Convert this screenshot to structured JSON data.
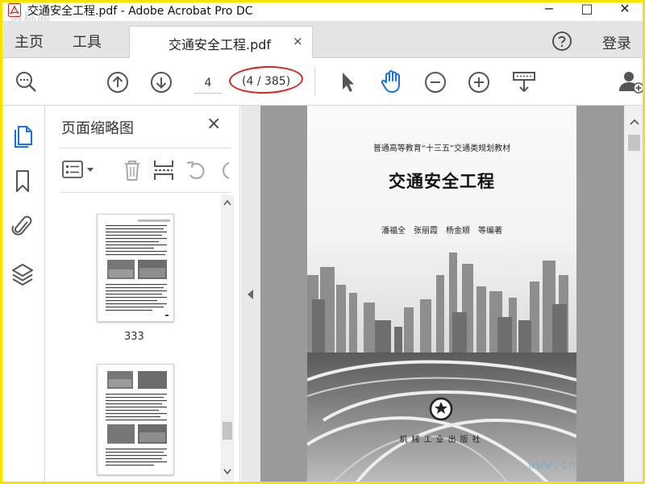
{
  "window": {
    "title": "交通安全工程.pdf - Adobe Acrobat Pro DC",
    "minimize_label": "−",
    "maximize_label": "□",
    "close_label": "✕",
    "watermark_text": "道称网"
  },
  "tabs": {
    "home_label": "主页",
    "tools_label": "工具",
    "document_label": "交通安全工程.pdf",
    "document_close": "×",
    "sign_in_label": "登录"
  },
  "toolbar": {
    "current_page": "4",
    "page_count": "(4 / 385)",
    "icons": [
      "search-icon",
      "previous-page-icon",
      "next-page-icon",
      "select-arrow-icon",
      "hand-tool-icon",
      "zoom-out-icon",
      "zoom-in-icon",
      "page-fit-icon",
      "share-user-icon"
    ],
    "accent_color": "#1473e6",
    "annotation_color": "#d9241c"
  },
  "sidebar": {
    "icons": [
      "page-thumbnails-icon",
      "bookmark-icon",
      "attachment-icon",
      "layers-icon"
    ]
  },
  "thumbnails_panel": {
    "title": "页面缩略图",
    "close": "×",
    "thumbnails": [
      {
        "label": "333"
      },
      {
        "label": ""
      }
    ]
  },
  "document": {
    "series": "普通高等教育“十三五”交通类规划教材",
    "title": "交通安全工程",
    "authors": "潘福全　张丽霞　杨金顺　等编著",
    "publisher": "机械工业出版社",
    "watermark": "www.cn"
  }
}
